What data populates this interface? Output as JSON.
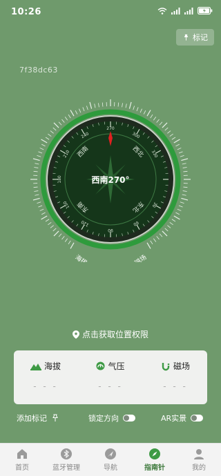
{
  "status": {
    "time": "10:26"
  },
  "header": {
    "mark_label": "标记"
  },
  "device_id": "7f38dc63",
  "compass": {
    "heading_text": "西南270°",
    "outer_left_label": "海拔",
    "outer_right_label": "磁场",
    "north_needle_color": "#e02020",
    "ring_color": "#2e9b3c"
  },
  "permission": {
    "text": "点击获取位置权限"
  },
  "stats": [
    {
      "label": "海拔",
      "value": "- - -"
    },
    {
      "label": "气压",
      "value": "- - -"
    },
    {
      "label": "磁场",
      "value": "- - -"
    }
  ],
  "options": {
    "add_mark": "添加标记",
    "lock_direction": "锁定方向",
    "ar_view": "AR实景"
  },
  "tabs": [
    {
      "label": "首页"
    },
    {
      "label": "蓝牙管理"
    },
    {
      "label": "导航"
    },
    {
      "label": "指南针"
    },
    {
      "label": "我的"
    }
  ],
  "accent_color": "#3e7a3d"
}
